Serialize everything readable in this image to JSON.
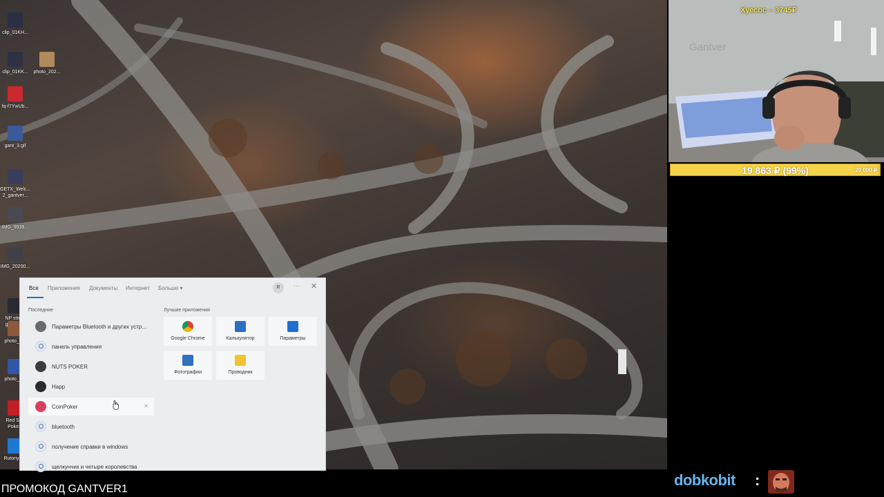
{
  "desktop": {
    "icons": [
      {
        "label": "clip_01KH...",
        "color": "#2b2f45"
      },
      {
        "label": "clip_01KK...",
        "color": "#2e3144"
      },
      {
        "label": "photo_202...",
        "color": "#b08a5a"
      },
      {
        "label": "fq-f7YwUb...",
        "color": "#c9292f"
      },
      {
        "label": "gant_3.gif",
        "color": "#3b5a9a"
      },
      {
        "label": "GETX_Welc... 2_gantver...",
        "color": "#3a3d5c"
      },
      {
        "label": "IMG_9939...",
        "color": "#4a4a52"
      },
      {
        "label": "IMG_20200...",
        "color": "#404048"
      },
      {
        "label": "NP stre... gantver...",
        "color": "#2a2a33"
      },
      {
        "label": "photo_2...",
        "color": "#8a5a3a"
      },
      {
        "label": "photo_2...",
        "color": "#2f57a6"
      },
      {
        "label": "Red St... Poke...",
        "color": "#c21f24"
      },
      {
        "label": "RutonyC...",
        "color": "#1f78d1"
      }
    ]
  },
  "search_panel": {
    "tabs": [
      "Все",
      "Приложения",
      "Документы",
      "Интернет",
      "Больше ▾"
    ],
    "avatar_letter": "R",
    "more": "···",
    "close": "✕",
    "recent_title": "Последние",
    "recent": [
      {
        "label": "Параметры Bluetooth и других устр...",
        "icon": "settings-icon",
        "color": "#6b6b6b"
      },
      {
        "label": "панель управления",
        "icon": "search-icon",
        "color": "#3d6fb6"
      },
      {
        "label": "NUTS POKER",
        "icon": "nuts-poker-icon",
        "color": "#3c3c3c"
      },
      {
        "label": "Happ",
        "icon": "happ-icon",
        "color": "#2b2b2b"
      },
      {
        "label": "CoinPoker",
        "icon": "coinpoker-icon",
        "color": "#d7415e",
        "removable": "✕"
      },
      {
        "label": "bluetooth",
        "icon": "search-icon",
        "color": "#3d6fb6"
      },
      {
        "label": "получение справки в windows",
        "icon": "search-icon",
        "color": "#3d6fb6"
      },
      {
        "label": "щелкунчик и четыре королевства",
        "icon": "search-icon",
        "color": "#3d6fb6"
      }
    ],
    "best_title": "Лучшие приложения",
    "apps": [
      {
        "label": "Google Chrome",
        "icon": "chrome-icon",
        "color": "#db4437"
      },
      {
        "label": "Калькулятор",
        "icon": "calculator-icon",
        "color": "#2a6fc4"
      },
      {
        "label": "Параметры",
        "icon": "gear-icon",
        "color": "#1f6fd0"
      },
      {
        "label": "Фотографии",
        "icon": "photos-icon",
        "color": "#2f6fbf"
      },
      {
        "label": "Проводник",
        "icon": "folder-icon",
        "color": "#f2c431"
      }
    ]
  },
  "stream": {
    "donation": "Хуесос – 3745₽",
    "wall_text": "Gantver",
    "goal_amount": "19 863 ₽ (99%)",
    "goal_target": "20 000 ₽",
    "goal_progress": 0.99,
    "promo": "ПРОМОКОД GANTVER1",
    "chat_user": "dobkobit",
    "chat_colon": ":"
  }
}
